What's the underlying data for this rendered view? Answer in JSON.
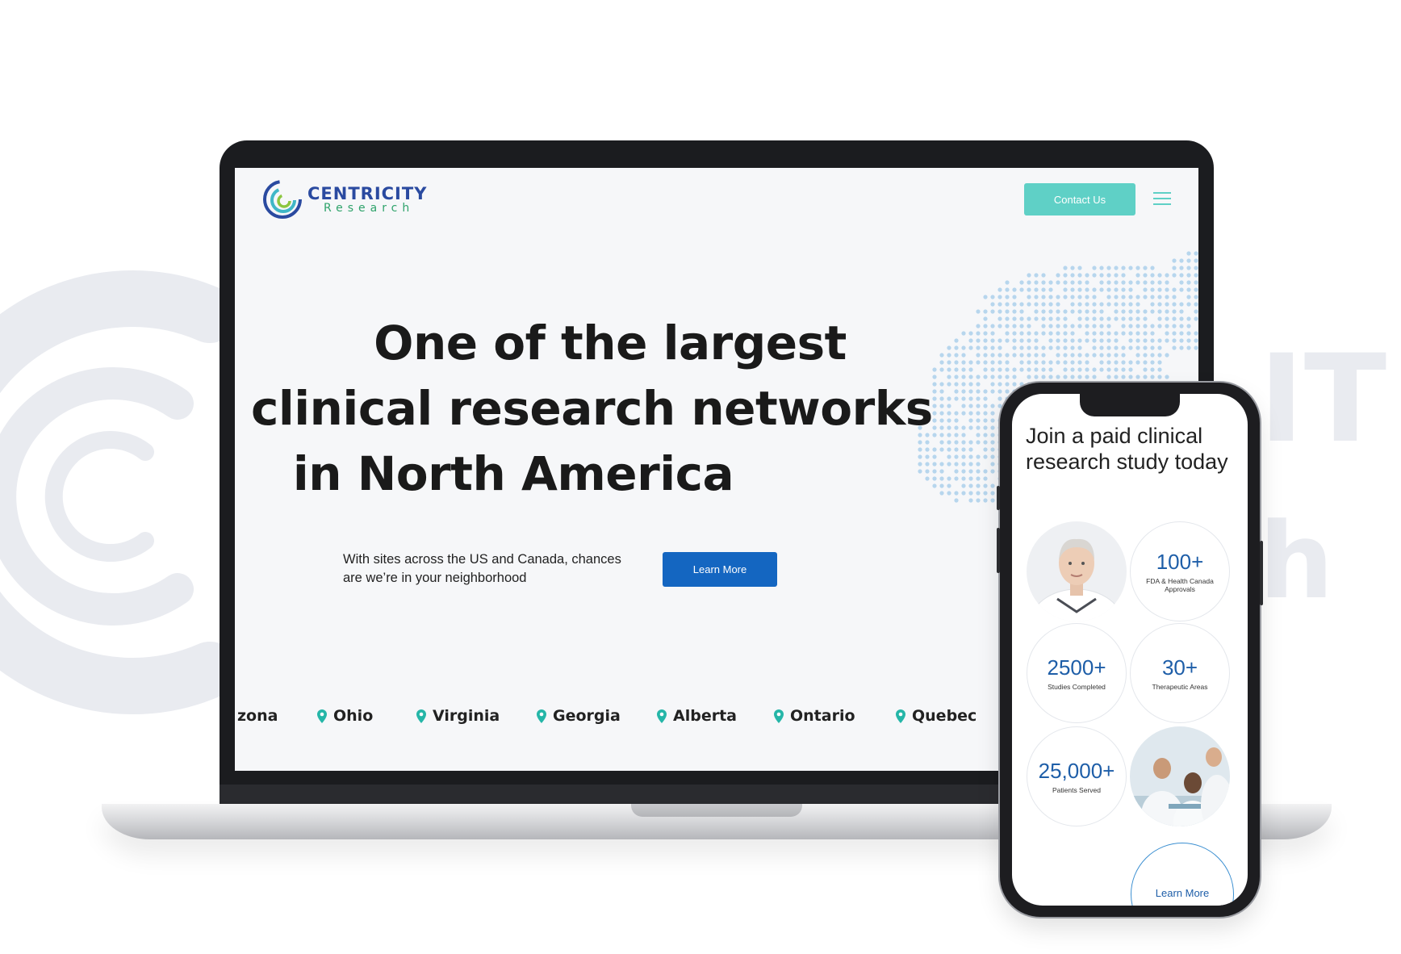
{
  "site": {
    "logo": {
      "name": "CENTRICITY",
      "sub": "Research"
    },
    "nav": {
      "contact_label": "Contact Us"
    },
    "hero": {
      "lines": [
        "One of the largest",
        "clinical research networks",
        "in North America"
      ],
      "subtitle": "With sites across the US and Canada, chances are we’re in your neighborhood",
      "cta_label": "Learn More"
    },
    "locations": [
      "zona",
      "Ohio",
      "Virginia",
      "Georgia",
      "Alberta",
      "Ontario",
      "Quebec"
    ]
  },
  "mobile": {
    "title": "Join a paid clinical research study today",
    "stats": [
      {
        "value": "100+",
        "label": "FDA & Health Canada Approvals"
      },
      {
        "value": "2500+",
        "label": "Studies Completed"
      },
      {
        "value": "30+",
        "label": "Therapeutic Areas"
      },
      {
        "value": "25,000+",
        "label": "Patients Served"
      }
    ],
    "cta_label": "Learn More"
  },
  "colors": {
    "teal": "#5fd0c6",
    "brand_blue": "#1466c1",
    "stat_blue": "#1e5ea8",
    "logo_green": "#2fa36b"
  },
  "icons": [
    "logo-swirl-icon",
    "menu-icon",
    "location-pin-icon"
  ]
}
